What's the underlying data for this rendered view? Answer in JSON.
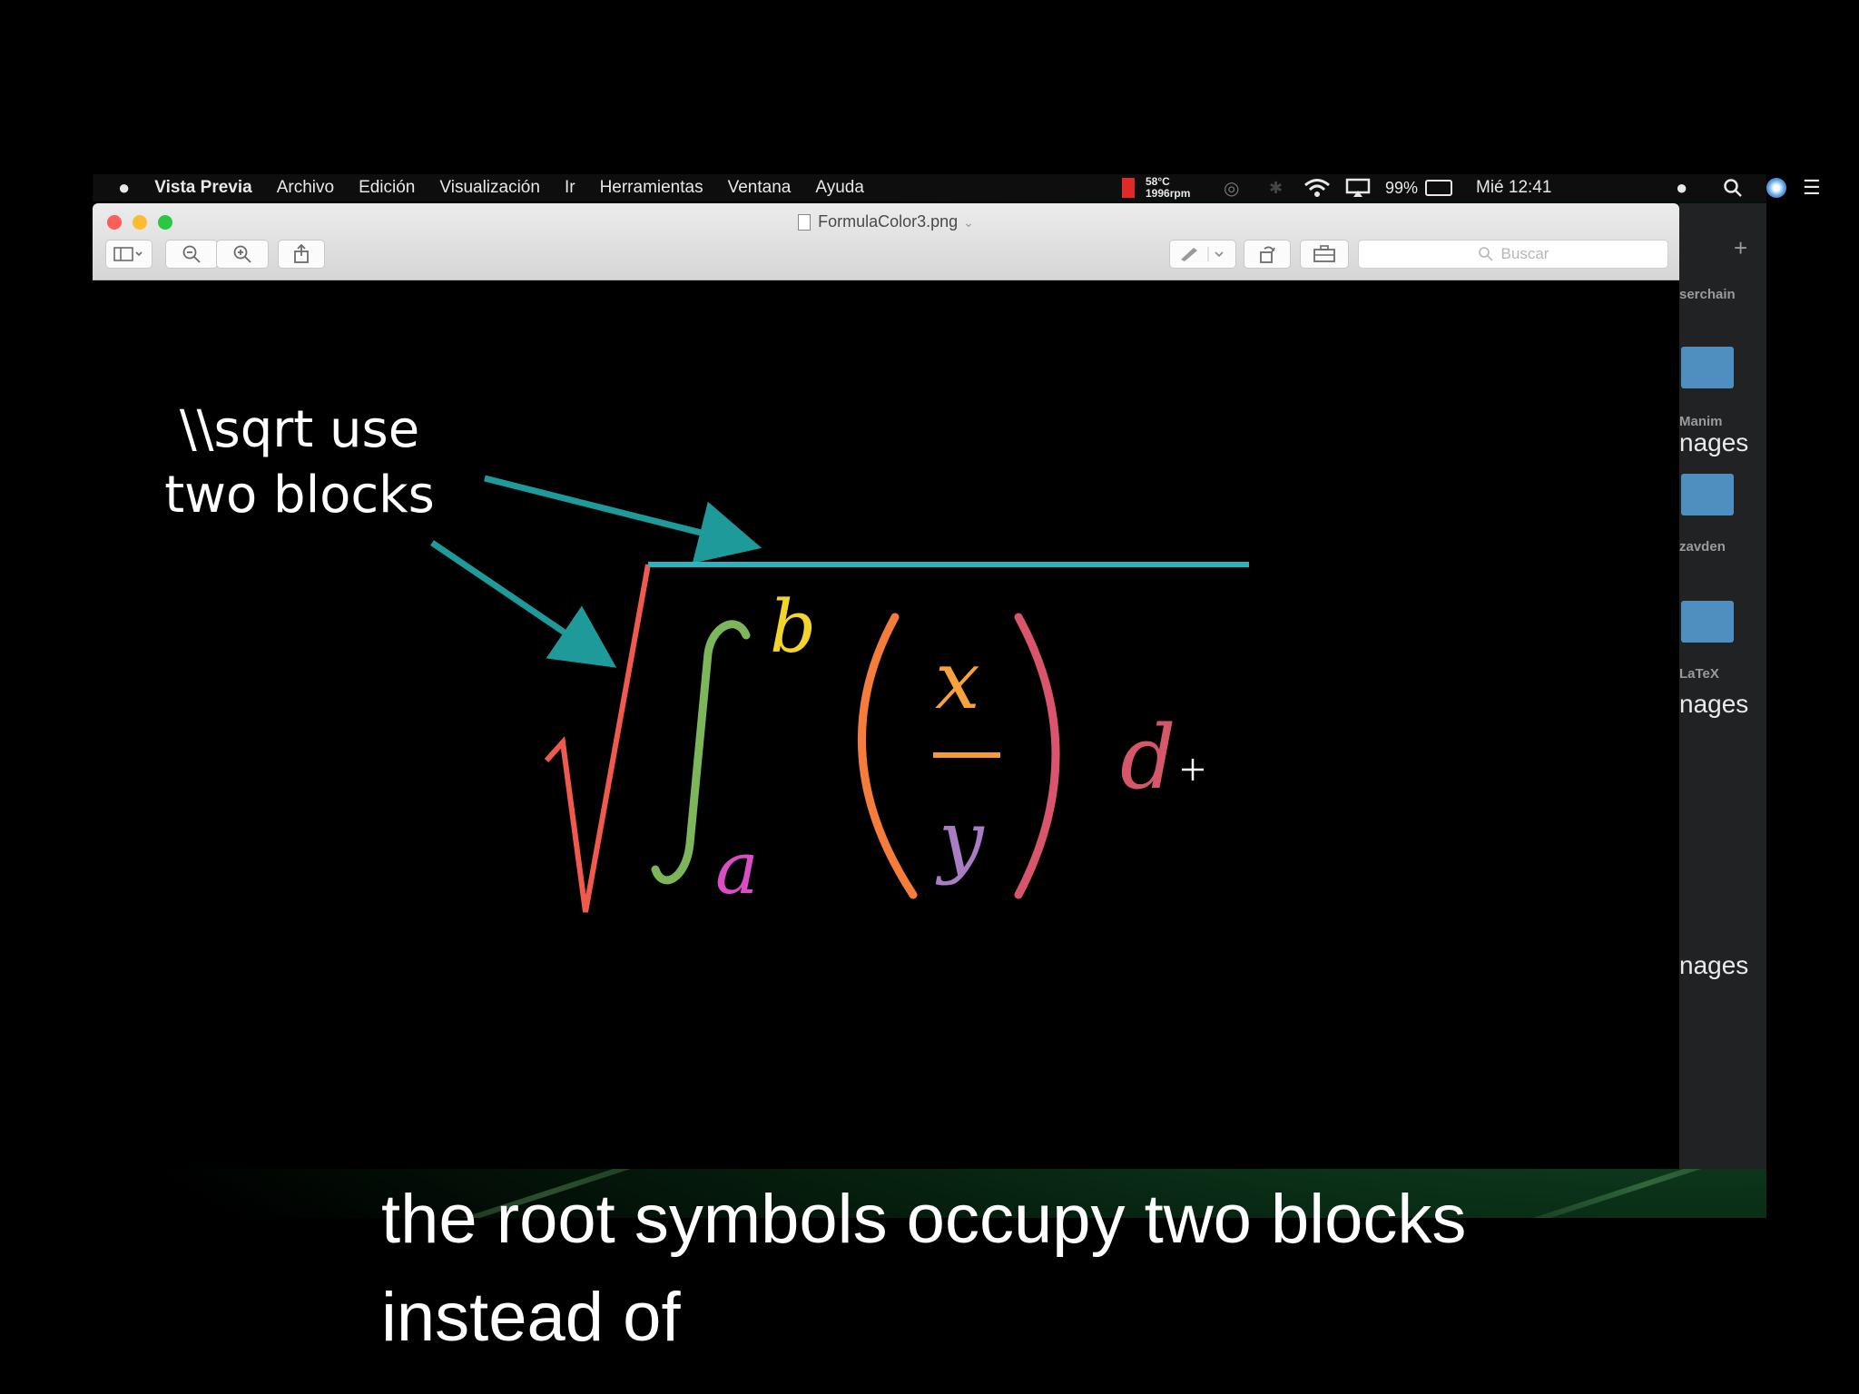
{
  "menubar": {
    "apple_icon": "apple-logo",
    "app_name": "Vista Previa",
    "items": [
      "Archivo",
      "Edición",
      "Visualización",
      "Ir",
      "Herramientas",
      "Ventana",
      "Ayuda"
    ],
    "temperature": "58°C",
    "fan_speed": "1996rpm",
    "battery": "99%",
    "clock": "Mié 12:41"
  },
  "window": {
    "title": "FormulaColor3.png",
    "search_placeholder": "Buscar"
  },
  "finder": {
    "labels": [
      "serchain",
      "Manim",
      "nages",
      "zavden",
      "LaTeX",
      "nages",
      "nages"
    ]
  },
  "formula": {
    "upper_limit": "b",
    "lower_limit": "a",
    "numerator": "x",
    "denominator": "y",
    "differential": "d",
    "colors": {
      "radical": "#f05a4c",
      "vinculum": "#2bb3c2",
      "integral": "#7cb55a",
      "upper_limit": "#f2d52c",
      "lower_limit": "#d94ec4",
      "parens": "#f57c3a",
      "numerator": "#f7a23a",
      "fraction_bar": "#f79a3a",
      "denominator": "#a77ec4",
      "right_paren": "#d9556b",
      "differential": "#d4586a",
      "arrows": "#1f9a9a"
    }
  },
  "annotation": {
    "line1": "\\\\sqrt use",
    "line2": "two blocks"
  },
  "caption": {
    "line1": "the root symbols occupy two blocks",
    "line2": "instead of"
  }
}
